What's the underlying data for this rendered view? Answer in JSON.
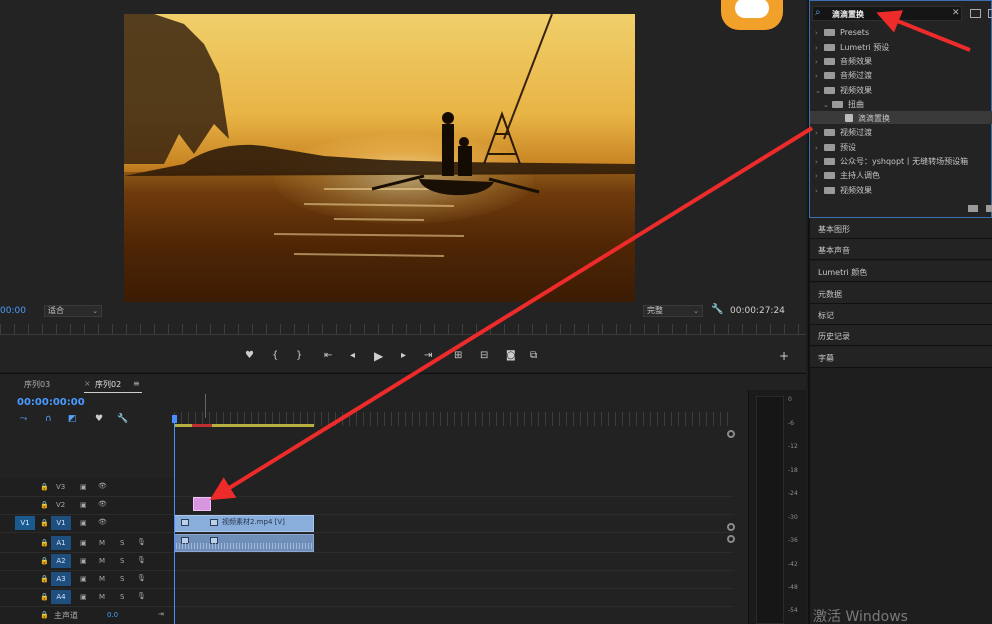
{
  "monitor": {
    "timecode_current": "00:00",
    "fit_label": "适合",
    "quality_label": "完整",
    "timecode_duration": "00:00:27:24",
    "transport_icons": [
      "marker-icon",
      "in-point-icon",
      "out-point-icon",
      "go-to-in-icon",
      "step-back-icon",
      "play-icon",
      "step-forward-icon",
      "go-to-out-icon",
      "lift-icon",
      "extract-icon",
      "export-frame-icon",
      "compare-icon",
      "add-button-icon"
    ]
  },
  "timeline": {
    "tabs": [
      {
        "label": "序列03"
      },
      {
        "label": "序列02"
      }
    ],
    "close_glyph": "×",
    "menu_glyph": "≡",
    "timecode": "00:00:00:00",
    "tracks": {
      "video": [
        {
          "name": "V3"
        },
        {
          "name": "V2"
        },
        {
          "name": "V1",
          "source": "V1"
        }
      ],
      "audio": [
        {
          "name": "A1",
          "m": "M",
          "s": "S"
        },
        {
          "name": "A2",
          "m": "M",
          "s": "S"
        },
        {
          "name": "A3",
          "m": "M",
          "s": "S"
        },
        {
          "name": "A4",
          "m": "M",
          "s": "S"
        }
      ],
      "master": {
        "name": "主声道",
        "value": "0.0"
      }
    },
    "clip_video_label": "视频素材2.mp4 [V]"
  },
  "meters": {
    "db_labels": [
      "0",
      "-6",
      "-12",
      "-18",
      "-24",
      "-30",
      "-36",
      "-42",
      "-48",
      "-54"
    ]
  },
  "effects": {
    "search_value": "滴滴置换",
    "items": [
      {
        "label": "Presets",
        "expanded": false
      },
      {
        "label": "Lumetri 预设",
        "expanded": false
      },
      {
        "label": "音频效果",
        "expanded": false
      },
      {
        "label": "音频过渡",
        "expanded": false
      },
      {
        "label": "视频效果",
        "expanded": true
      },
      {
        "label": "扭曲",
        "expanded": true
      },
      {
        "label": "滴滴置换",
        "selected": true
      },
      {
        "label": "视频过渡",
        "expanded": false
      },
      {
        "label": "预设",
        "expanded": false
      },
      {
        "label": "公众号：yshqopt丨无缝转场预设箱",
        "expanded": false
      },
      {
        "label": "主持人调色",
        "expanded": false
      },
      {
        "label": "视频效果",
        "expanded": false
      }
    ]
  },
  "panels": [
    {
      "label": "基本图形"
    },
    {
      "label": "基本声音"
    },
    {
      "label": "Lumetri 颜色"
    },
    {
      "label": "元数据"
    },
    {
      "label": "标记"
    },
    {
      "label": "历史记录"
    },
    {
      "label": "字幕"
    }
  ],
  "watermark": "激活 Windows",
  "colors": {
    "accent_blue": "#4a9bff",
    "annotation_red": "#ee2b2b",
    "clip_video": "#8aaedc",
    "clip_audio": "#6f8fba"
  }
}
